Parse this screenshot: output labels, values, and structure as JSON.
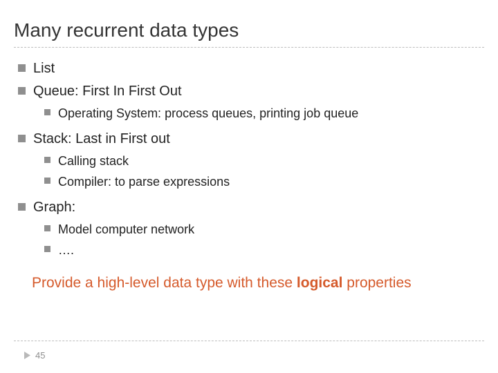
{
  "title": "Many recurrent data types",
  "items": {
    "list": "List",
    "queue": "Queue:  First In First Out",
    "queue_sub": {
      "os": "Operating System: process queues, printing job queue"
    },
    "stack": "Stack: Last in First out",
    "stack_sub": {
      "calling": "Calling stack",
      "compiler": "Compiler: to parse expressions"
    },
    "graph": "Graph:",
    "graph_sub": {
      "model": "Model computer network",
      "dots": "…."
    }
  },
  "conclusion": {
    "prefix": "Provide a high-level data type with these ",
    "bold": "logical",
    "suffix": " properties"
  },
  "page_number": "45"
}
